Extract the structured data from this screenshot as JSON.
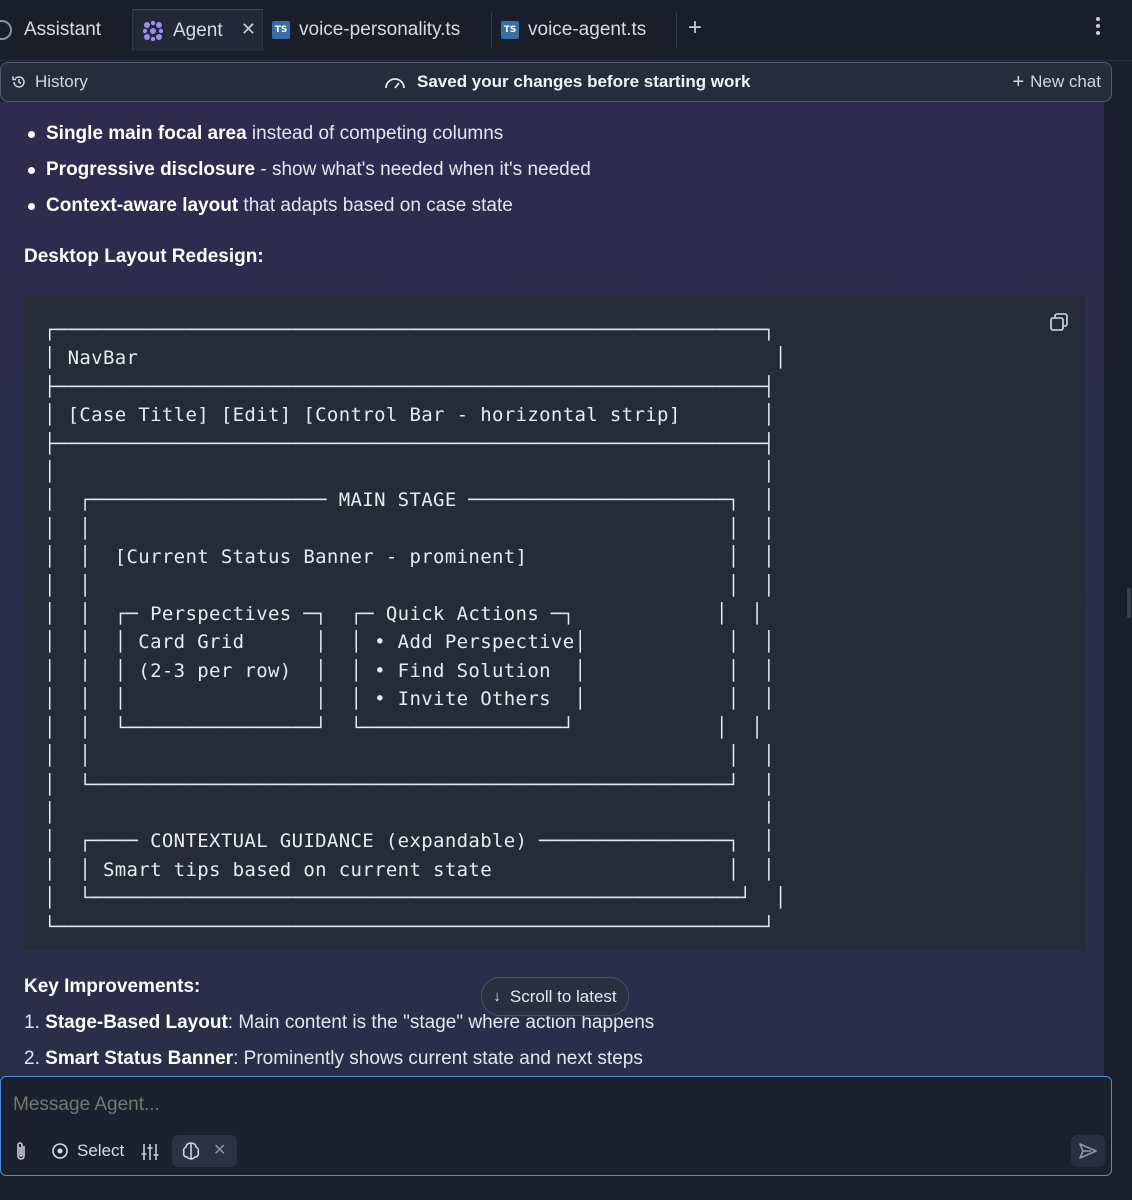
{
  "tabs": [
    {
      "label": "Assistant"
    },
    {
      "label": "Agent",
      "active": true
    },
    {
      "label": "voice-personality.ts",
      "badge": "TS"
    },
    {
      "label": "voice-agent.ts",
      "badge": "TS"
    }
  ],
  "header": {
    "history": "History",
    "status": "Saved your changes before starting work",
    "new_chat": "New chat"
  },
  "content": {
    "bullets": [
      {
        "bold": "Single main focal area",
        "rest": " instead of competing columns"
      },
      {
        "bold": "Progressive disclosure",
        "rest": " - show what's needed when it's needed"
      },
      {
        "bold": "Context-aware layout",
        "rest": " that adapts based on case state"
      }
    ],
    "section_title": "Desktop Layout Redesign:",
    "code": "┌────────────────────────────────────────────────────────────┐\n│ NavBar                                                      │\n├────────────────────────────────────────────────────────────┤\n│ [Case Title] [Edit] [Control Bar - horizontal strip]       │\n├────────────────────────────────────────────────────────────┤\n│                                                            │\n│  ┌──────────────────── MAIN STAGE ──────────────────────┐  │\n│  │                                                      │  │\n│  │  [Current Status Banner - prominent]                 │  │\n│  │                                                      │  │\n│  │  ┌─ Perspectives ─┐  ┌─ Quick Actions ─┐            │  │\n│  │  │ Card Grid      │  │ • Add Perspective│            │  │\n│  │  │ (2-3 per row)  │  │ • Find Solution  │            │  │\n│  │  │                │  │ • Invite Others  │            │  │\n│  │  └────────────────┘  └─────────────────┘            │  │\n│  │                                                      │  │\n│  └──────────────────────────────────────────────────────┘  │\n│                                                            │\n│  ┌──── CONTEXTUAL GUIDANCE (expandable) ────────────────┐  │\n│  │ Smart tips based on current state                    │  │\n│  └───────────────────────────────────────────────────────┘  │\n└────────────────────────────────────────────────────────────┘",
    "key_title": "Key Improvements:",
    "improvements": [
      {
        "num": "1.",
        "bold": "Stage-Based Layout",
        "rest": ": Main content is the \"stage\" where action happens"
      },
      {
        "num": "2.",
        "bold": "Smart Status Banner",
        "rest": ": Prominently shows current state and next steps"
      }
    ]
  },
  "scroll_to_latest": "Scroll to latest",
  "composer": {
    "placeholder": "Message Agent...",
    "select_label": "Select"
  },
  "colors": {
    "accent": "#4d8cdc",
    "agent_icon": "#9b8cf0",
    "ts_badge": "#3a6ea5"
  }
}
